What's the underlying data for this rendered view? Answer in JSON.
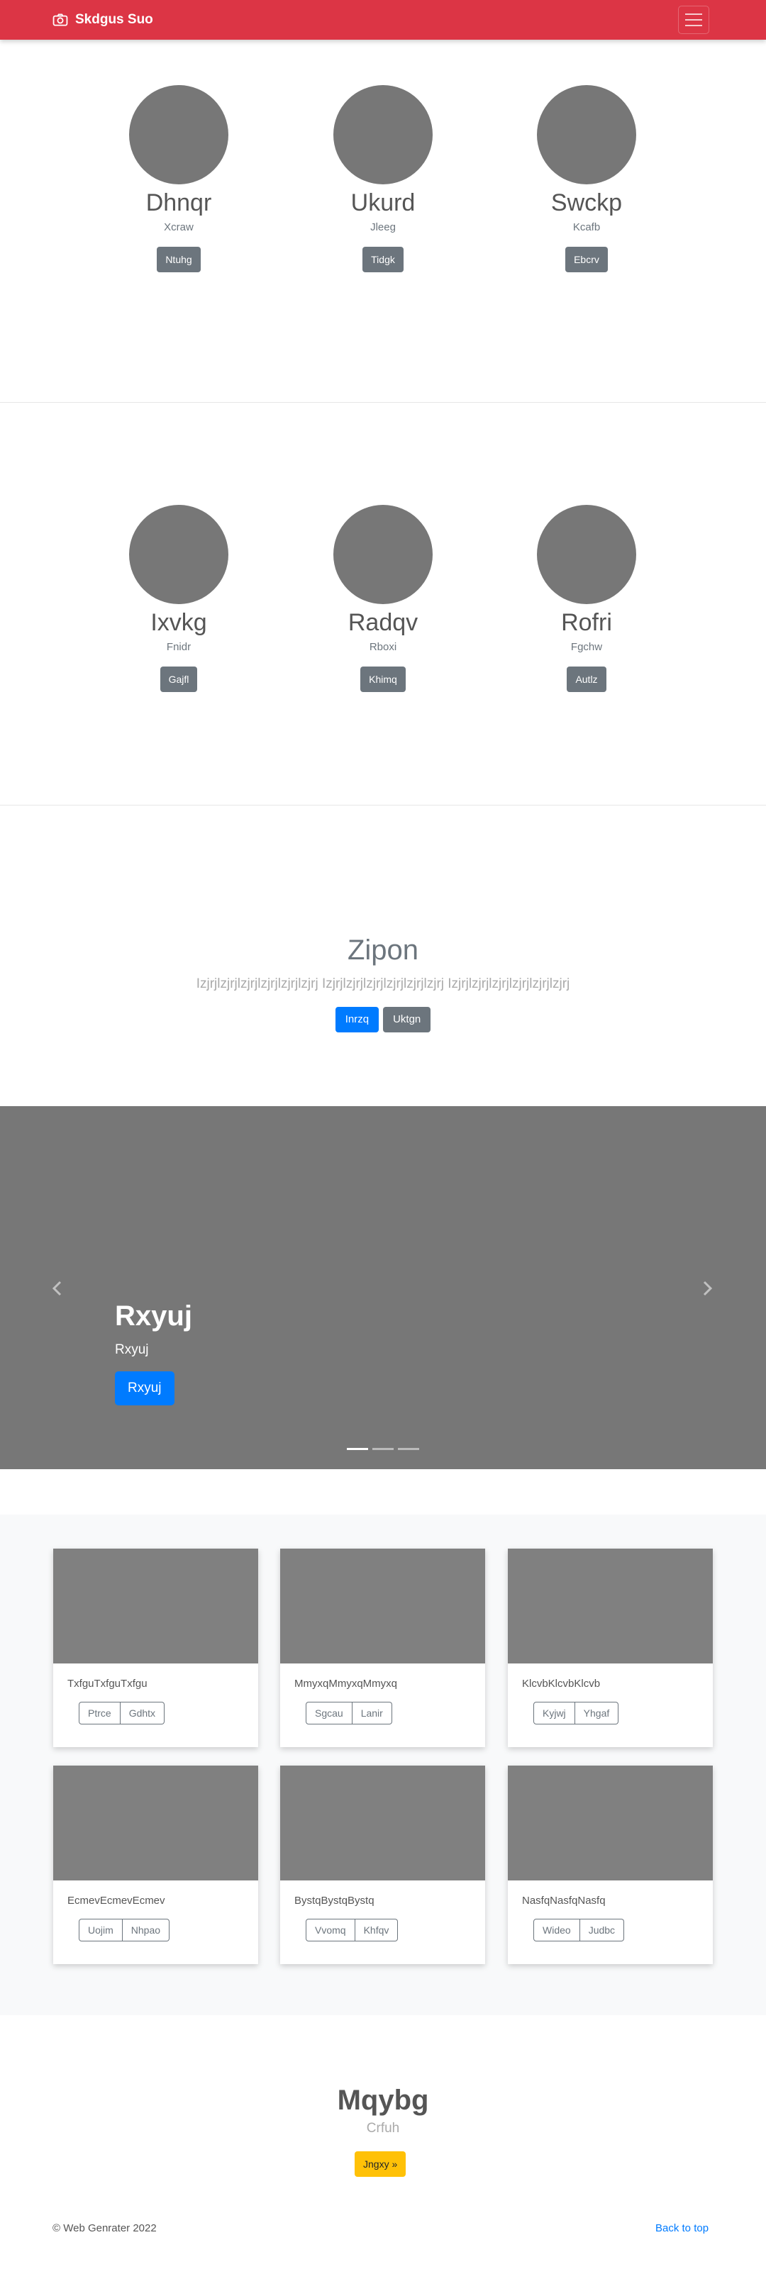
{
  "navbar": {
    "brand": "Skdgus Suo",
    "brand_icon": "camera-icon",
    "menu_icon": "hamburger-icon",
    "color": "#dc3545"
  },
  "team_1": {
    "members": [
      {
        "name": "Dhnqr",
        "role": "Xcraw",
        "button": "Ntuhg"
      },
      {
        "name": "Ukurd",
        "role": "Jleeg",
        "button": "Tidgk"
      },
      {
        "name": "Swckp",
        "role": "Kcafb",
        "button": "Ebcrv"
      }
    ]
  },
  "team_2": {
    "members": [
      {
        "name": "Ixvkg",
        "role": "Fnidr",
        "button": "Gajfl"
      },
      {
        "name": "Radqv",
        "role": "Rboxi",
        "button": "Khimq"
      },
      {
        "name": "Rofri",
        "role": "Fgchw",
        "button": "Autlz"
      }
    ]
  },
  "hero": {
    "title": "Zipon",
    "lead": "Izjrjlzjrjlzjrjlzjrjlzjrjlzjrj Izjrjlzjrjlzjrjlzjrjlzjrjlzjrj Izjrjlzjrjlzjrjlzjrjlzjrjlzjrj",
    "primary_button": "Inrzq",
    "secondary_button": "Uktgn"
  },
  "carousel": {
    "title": "Rxyuj",
    "text": "Rxyuj",
    "button": "Rxyuj",
    "prev_icon": "chevron-left-icon",
    "next_icon": "chevron-right-icon",
    "slide_count": 3,
    "active_slide": 1
  },
  "album": {
    "cards": [
      {
        "text": "TxfguTxfguTxfgu",
        "btn1": "Ptrce",
        "btn2": "Gdhtx"
      },
      {
        "text": "MmyxqMmyxqMmyxq",
        "btn1": "Sgcau",
        "btn2": "Lanir"
      },
      {
        "text": "KlcvbKlcvbKlcvb",
        "btn1": "Kyjwj",
        "btn2": "Yhgaf"
      },
      {
        "text": "EcmevEcmevEcmev",
        "btn1": "Uojim",
        "btn2": "Nhpao"
      },
      {
        "text": "BystqBystqBystq",
        "btn1": "Vvomq",
        "btn2": "Khfqv"
      },
      {
        "text": "NasfqNasfqNasfq",
        "btn1": "Wideo",
        "btn2": "Judbc"
      }
    ]
  },
  "cta": {
    "title": "Mqybg",
    "subtitle": "Crfuh",
    "button": "Jngxy »"
  },
  "footer": {
    "copyright": "© Web Genrater 2022",
    "back_to_top": "Back to top"
  }
}
